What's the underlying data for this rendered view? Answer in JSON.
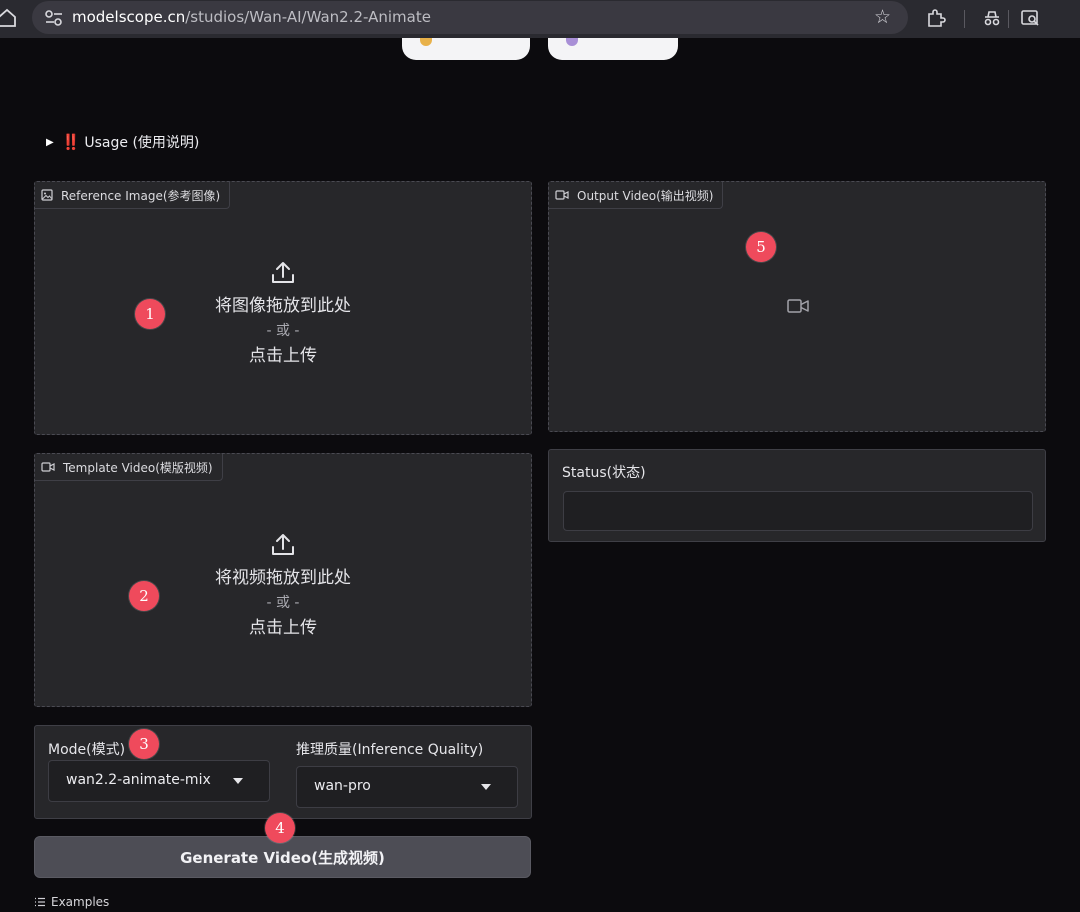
{
  "browser": {
    "url_host": "modelscope.cn",
    "url_path": "/studios/Wan-AI/Wan2.2-Animate"
  },
  "usage": {
    "label": "Usage (使用说明)",
    "marker": "‼️"
  },
  "reference_image": {
    "label": "Reference Image(参考图像)",
    "drop_text": "将图像拖放到此处",
    "or_text": "- 或 -",
    "click_text": "点击上传"
  },
  "template_video": {
    "label": "Template Video(模版视频)",
    "drop_text": "将视频拖放到此处",
    "or_text": "- 或 -",
    "click_text": "点击上传"
  },
  "output_video": {
    "label": "Output Video(输出视频)"
  },
  "status": {
    "label": "Status(状态)",
    "value": ""
  },
  "mode": {
    "label": "Mode(模式)",
    "value": "wan2.2-animate-mix"
  },
  "quality": {
    "label": "推理质量(Inference Quality)",
    "value": "wan-pro"
  },
  "generate": {
    "label": "Generate Video(生成视频)"
  },
  "examples": {
    "label": "Examples"
  },
  "badges": {
    "b1": "1",
    "b2": "2",
    "b3": "3",
    "b4": "4",
    "b5": "5"
  },
  "colors": {
    "badge": "#ef4a5c",
    "background": "#0c0b0e",
    "panel": "#27272a",
    "accent_marker": "#ff2a3a"
  },
  "icons": [
    "home-icon",
    "site-settings-icon",
    "star-icon",
    "extension-icon",
    "incognito-icon",
    "search-tab-icon",
    "image-icon",
    "video-camera-icon",
    "upload-icon",
    "list-icon"
  ]
}
